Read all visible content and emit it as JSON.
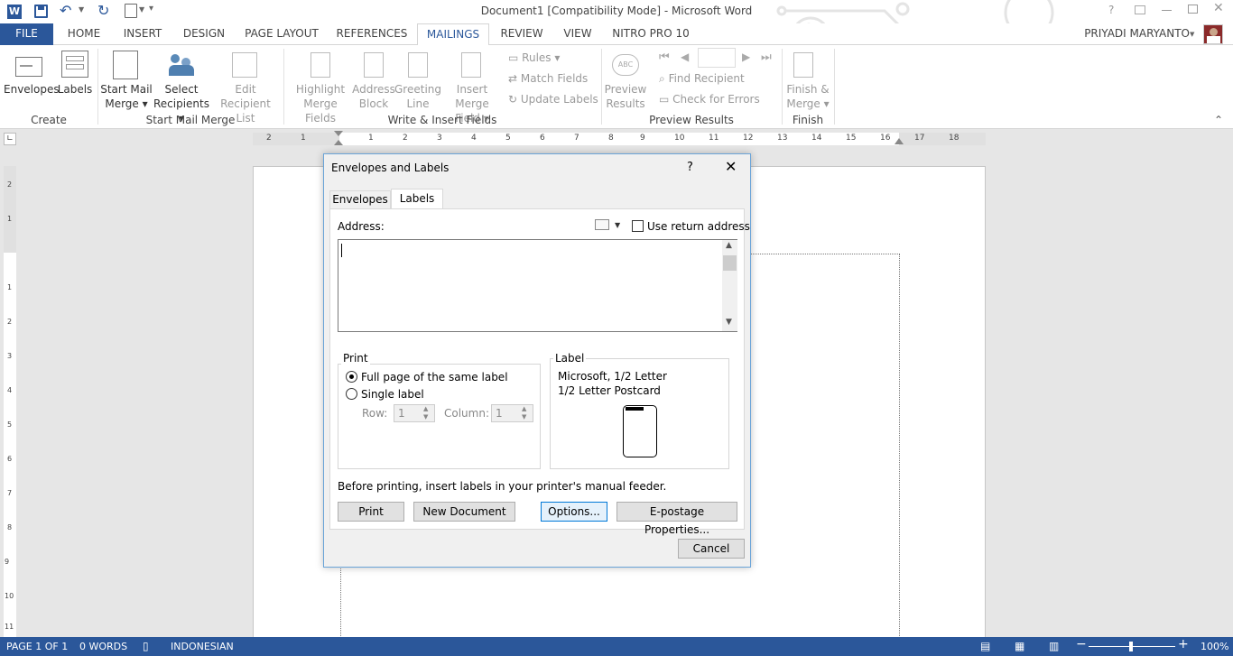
{
  "window": {
    "title": "Document1 [Compatibility Mode] - Microsoft Word",
    "help": "?"
  },
  "ribbon_tabs": [
    {
      "label": "FILE"
    },
    {
      "label": "HOME"
    },
    {
      "label": "INSERT"
    },
    {
      "label": "DESIGN"
    },
    {
      "label": "PAGE LAYOUT"
    },
    {
      "label": "REFERENCES"
    },
    {
      "label": "MAILINGS"
    },
    {
      "label": "REVIEW"
    },
    {
      "label": "VIEW"
    },
    {
      "label": "NITRO PRO 10"
    }
  ],
  "user": {
    "name": "PRIYADI MARYANTO"
  },
  "ribbon": {
    "envelopes": "Envelopes",
    "labels": "Labels",
    "start_mail_merge_1": "Start Mail",
    "start_mail_merge_2": "Merge",
    "select_recipients_1": "Select",
    "select_recipients_2": "Recipients",
    "edit_list_1": "Edit",
    "edit_list_2": "Recipient List",
    "highlight_1": "Highlight",
    "highlight_2": "Merge Fields",
    "address_1": "Address",
    "address_2": "Block",
    "greeting_1": "Greeting",
    "greeting_2": "Line",
    "insert_merge_1": "Insert Merge",
    "insert_merge_2": "Field",
    "rules": "Rules",
    "match_fields": "Match Fields",
    "update_labels": "Update Labels",
    "preview_1": "Preview",
    "preview_2": "Results",
    "find_recipient": "Find Recipient",
    "check_errors": "Check for Errors",
    "finish_1": "Finish &",
    "finish_2": "Merge",
    "groups": {
      "create": "Create",
      "start": "Start Mail Merge",
      "write": "Write & Insert Fields",
      "preview": "Preview Results",
      "finish": "Finish"
    }
  },
  "ruler_h": [
    "2",
    "1",
    "1",
    "2",
    "3",
    "4",
    "5",
    "6",
    "7",
    "8",
    "9",
    "10",
    "11",
    "12",
    "13",
    "14",
    "15",
    "16",
    "17",
    "18"
  ],
  "ruler_v": [
    "2",
    "1",
    "1",
    "2",
    "3",
    "4",
    "5",
    "6",
    "7",
    "8",
    "9",
    "10",
    "11"
  ],
  "dialog": {
    "title": "Envelopes and Labels",
    "help": "?",
    "tab_envelopes": "Envelopes",
    "tab_labels": "Labels",
    "address_label": "Address:",
    "use_return": "Use return address",
    "address_value": "",
    "print_group": "Print",
    "full_page": "Full page of the same label",
    "single_label": "Single label",
    "row_label": "Row:",
    "row_value": "1",
    "column_label": "Column:",
    "column_value": "1",
    "label_group": "Label",
    "label_line1": "Microsoft, 1/2 Letter",
    "label_line2": "1/2 Letter Postcard",
    "note": "Before printing, insert labels in your printer's manual feeder.",
    "btn_print": "Print",
    "btn_new_doc": "New Document",
    "btn_options": "Options...",
    "btn_epostage": "E-postage Properties...",
    "btn_cancel": "Cancel"
  },
  "status": {
    "page": "PAGE 1 OF 1",
    "words": "0 WORDS",
    "language": "INDONESIAN",
    "zoom": "100%",
    "zoom_level_percent": 100
  },
  "colors": {
    "accent": "#2b579a",
    "file_tab": "#2b579a",
    "dialog_border": "#6aa4d8"
  }
}
